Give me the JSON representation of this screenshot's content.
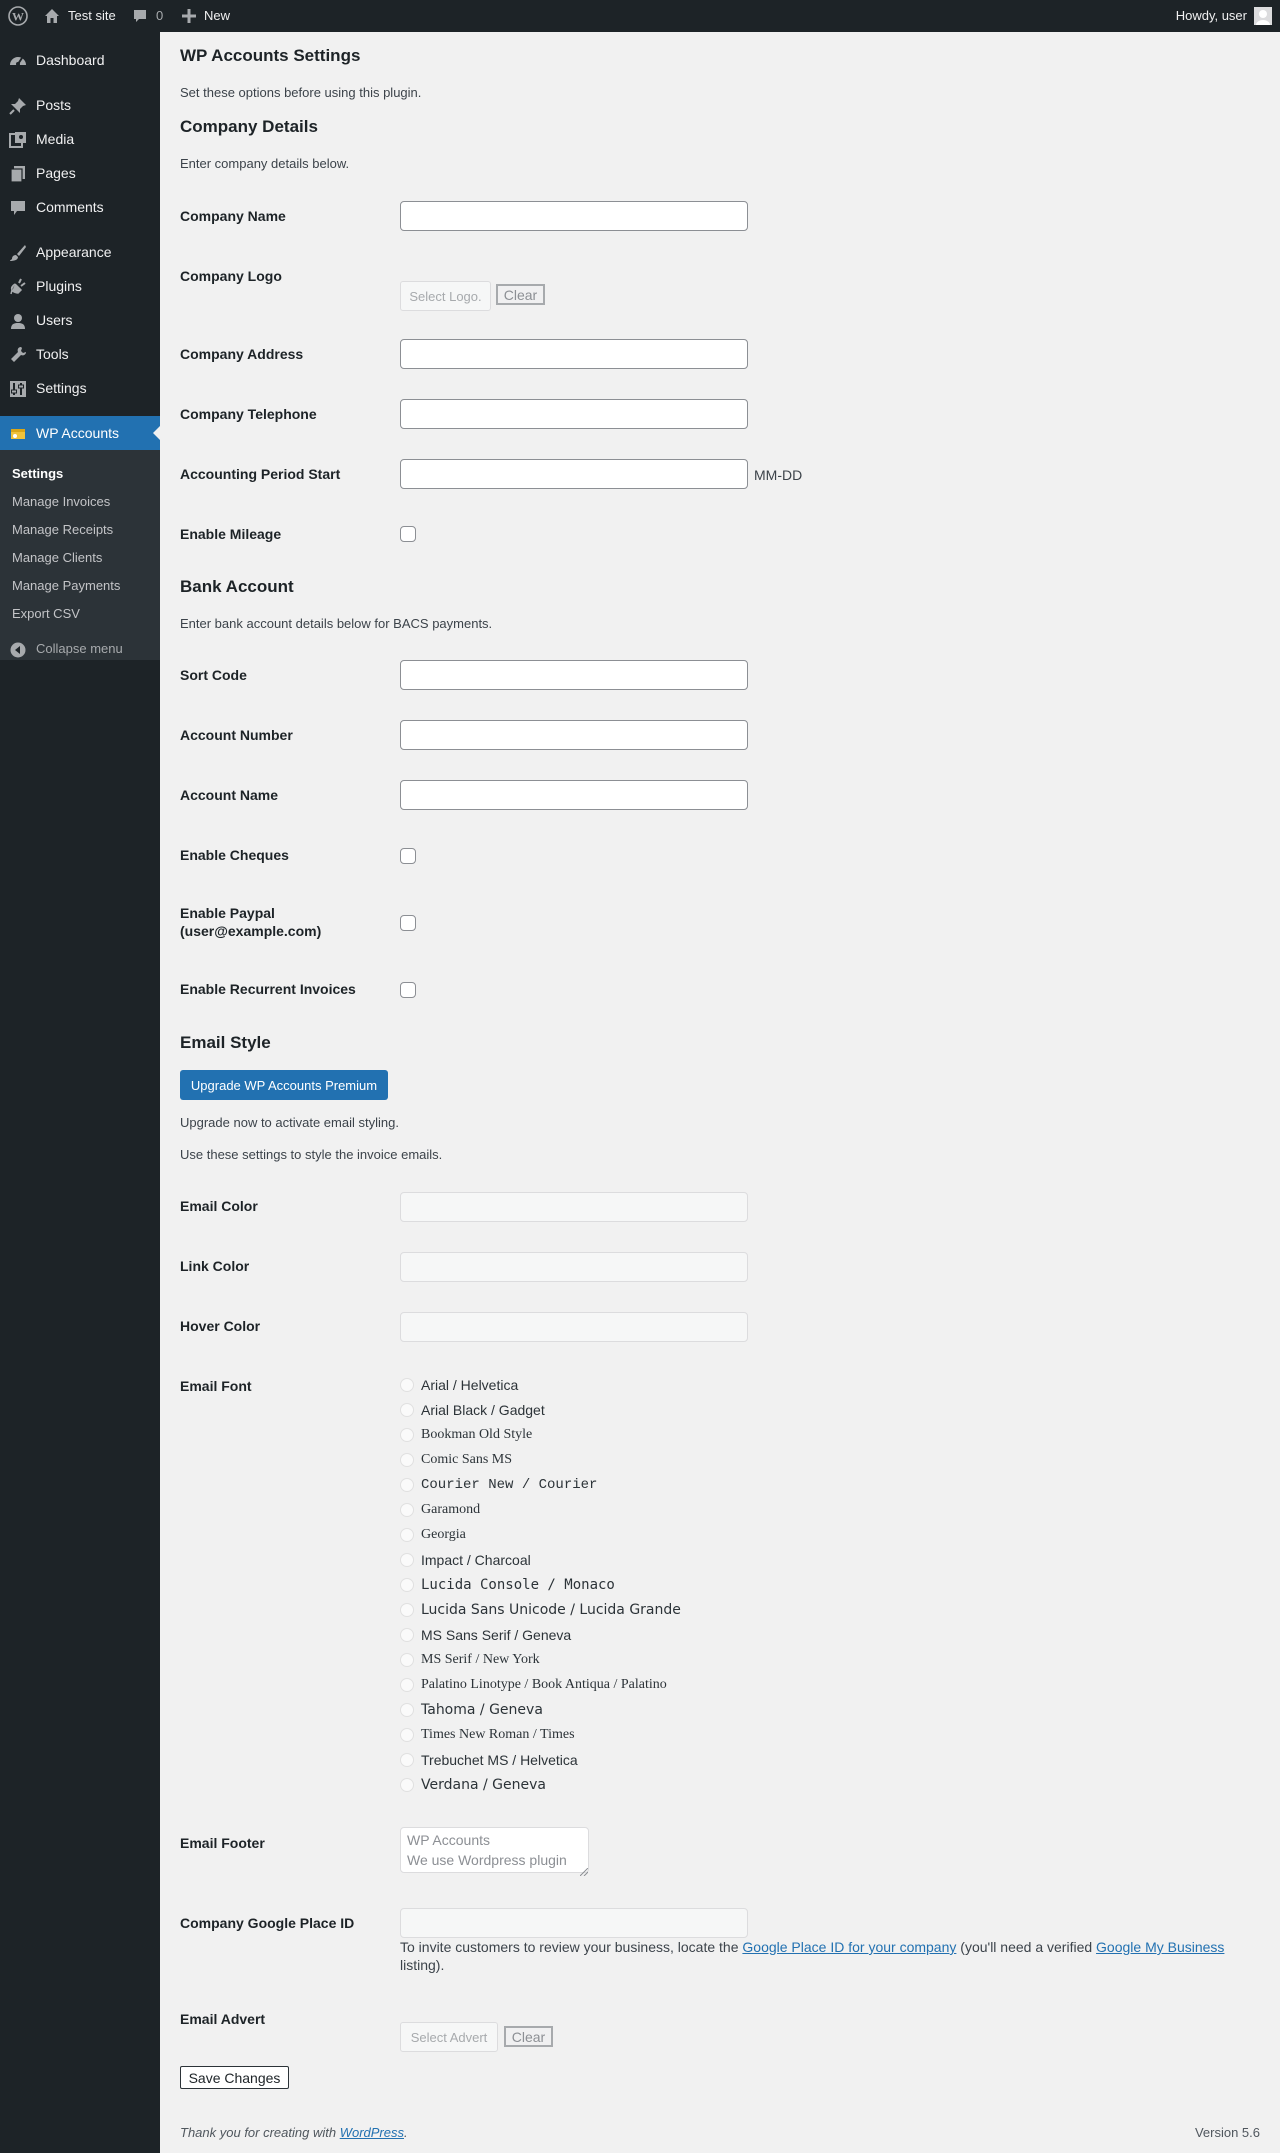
{
  "adminbar": {
    "site_name": "Test site",
    "comments_count": "0",
    "new_label": "New",
    "howdy": "Howdy, user"
  },
  "sidebar": {
    "items": [
      {
        "label": "Dashboard",
        "icon": "dashboard-icon"
      },
      {
        "label": "Posts",
        "icon": "pin-icon"
      },
      {
        "label": "Media",
        "icon": "media-icon"
      },
      {
        "label": "Pages",
        "icon": "pages-icon"
      },
      {
        "label": "Comments",
        "icon": "comment-icon"
      },
      {
        "label": "Appearance",
        "icon": "brush-icon"
      },
      {
        "label": "Plugins",
        "icon": "plugin-icon"
      },
      {
        "label": "Users",
        "icon": "user-icon"
      },
      {
        "label": "Tools",
        "icon": "wrench-icon"
      },
      {
        "label": "Settings",
        "icon": "settings-icon"
      },
      {
        "label": "WP Accounts",
        "icon": "accounts-icon"
      }
    ],
    "submenu": [
      "Settings",
      "Manage Invoices",
      "Manage Receipts",
      "Manage Clients",
      "Manage Payments",
      "Export CSV"
    ],
    "collapse": "Collapse menu"
  },
  "page": {
    "title": "WP Accounts Settings",
    "intro": "Set these options before using this plugin."
  },
  "company": {
    "heading": "Company Details",
    "desc": "Enter company details below.",
    "name_label": "Company Name",
    "logo_label": "Company Logo",
    "select_logo": "Select Logo.",
    "clear": "Clear",
    "address_label": "Company Address",
    "telephone_label": "Company Telephone",
    "period_label": "Accounting Period Start",
    "period_hint": "MM-DD",
    "mileage_label": "Enable Mileage"
  },
  "bank": {
    "heading": "Bank Account",
    "desc": "Enter bank account details below for BACS payments.",
    "sort_code_label": "Sort Code",
    "account_number_label": "Account Number",
    "account_name_label": "Account Name",
    "cheques_label": "Enable Cheques",
    "paypal_label_1": "Enable Paypal",
    "paypal_label_2": "(user@example.com)",
    "recurrent_label": "Enable Recurrent Invoices"
  },
  "email": {
    "heading": "Email Style",
    "upgrade_button": "Upgrade WP Accounts Premium",
    "upgrade_note": "Upgrade now to activate email styling.",
    "style_note": "Use these settings to style the invoice emails.",
    "color_label": "Email Color",
    "link_color_label": "Link Color",
    "hover_color_label": "Hover Color",
    "font_label": "Email Font",
    "fonts": [
      "Arial / Helvetica",
      "Arial Black / Gadget",
      "Bookman Old Style",
      "Comic Sans MS",
      "Courier New / Courier",
      "Garamond",
      "Georgia",
      "Impact / Charcoal",
      "Lucida Console / Monaco",
      "Lucida Sans Unicode / Lucida Grande",
      "MS Sans Serif / Geneva",
      "MS Serif / New York",
      "Palatino Linotype / Book Antiqua / Palatino",
      "Tahoma / Geneva",
      "Times New Roman / Times",
      "Trebuchet MS / Helvetica",
      "Verdana / Geneva"
    ],
    "footer_label": "Email Footer",
    "footer_value": "WP Accounts\nWe use Wordpress plugin",
    "place_id_label": "Company Google Place ID",
    "place_help_pre": "To invite customers to review your business, locate the ",
    "place_help_link1": "Google Place ID for your company",
    "place_help_mid": " (you'll need a verified ",
    "place_help_link2": "Google My Business",
    "place_help_post": "listing).",
    "advert_label": "Email Advert",
    "select_advert": "Select Advert",
    "clear": "Clear"
  },
  "save_button": "Save Changes",
  "footer": {
    "thanks_pre": "Thank you for creating with ",
    "thanks_link": "WordPress",
    "thanks_post": ".",
    "version": "Version 5.6"
  }
}
